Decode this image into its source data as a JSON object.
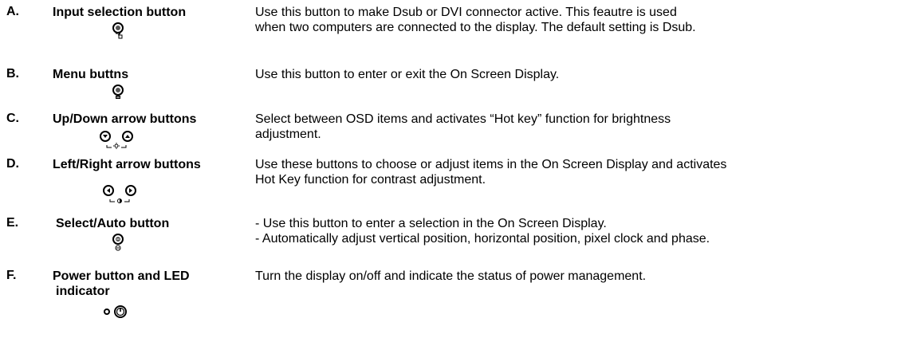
{
  "items": [
    {
      "letter": "A.",
      "name": "Input selection button",
      "desc": [
        "Use this button to make Dsub or DVI connector active. This feautre is used",
        "when two computers are connected to the display. The default setting is Dsub."
      ],
      "icon": "input-select-button-icon"
    },
    {
      "letter": "B.",
      "name": "Menu buttns",
      "desc": [
        "Use this button to enter or exit the On Screen Display."
      ],
      "icon": "menu-button-icon"
    },
    {
      "letter": "C.",
      "name": "Up/Down arrow buttons",
      "desc": [
        "Select between OSD items and activates “Hot key” function for brightness",
        "adjustment."
      ],
      "icon": "up-down-buttons-brightness-icon"
    },
    {
      "letter": "D.",
      "name": "Left/Right arrow buttons",
      "desc": [
        "Use these buttons to choose or adjust items in the On Screen Display and activates",
        "Hot Key function for contrast adjustment."
      ],
      "icon": "left-right-buttons-contrast-icon"
    },
    {
      "letter": "E.",
      "name": "Select/Auto button",
      "desc": [
        "- Use this button to enter a selection in the On Screen Display.",
        "- Automatically adjust vertical position, horizontal position, pixel clock and phase."
      ],
      "icon": "select-auto-button-icon"
    },
    {
      "letter": "F.",
      "name": [
        "Power button and LED",
        "indicator"
      ],
      "desc": [
        "Turn the display on/off and indicate the status of power management."
      ],
      "icon": "power-button-led-icon"
    }
  ]
}
